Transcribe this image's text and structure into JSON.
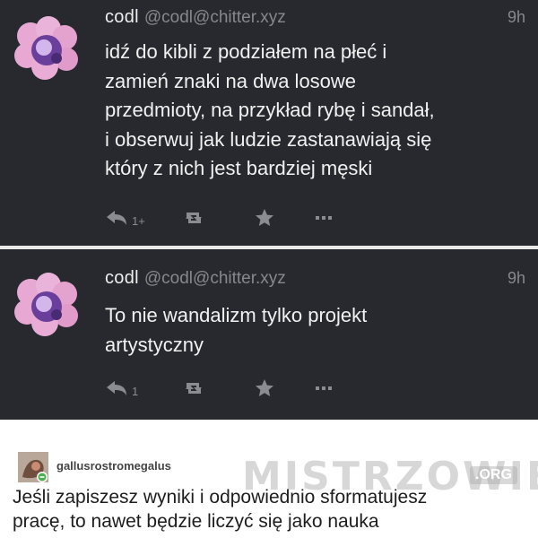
{
  "posts": [
    {
      "display_name": "codl",
      "handle": "@codl@chitter.xyz",
      "time": "9h",
      "text_lines": [
        "idź do kibli z podziałem na płeć i",
        "zamień znaki na dwa losowe",
        "przedmioty, na przykład rybę i sandał,",
        "i obserwuj jak ludzie zastanawiają się",
        "który z nich jest bardziej męski"
      ],
      "reply_count": "1+",
      "icons": {
        "reply": "reply-icon",
        "retweet": "boost-icon",
        "favourite": "star-icon",
        "more": "more-icon"
      }
    },
    {
      "display_name": "codl",
      "handle": "@codl@chitter.xyz",
      "time": "9h",
      "text_lines": [
        "To nie wandalizm tylko projekt",
        "artystyczny"
      ],
      "reply_count": "1",
      "icons": {
        "reply": "reply-icon",
        "retweet": "boost-icon",
        "favourite": "star-icon",
        "more": "more-icon"
      }
    }
  ],
  "comment": {
    "username": "gallusrostromegalus",
    "text_lines": [
      "Jeśli zapiszesz wyniki i odpowiednio sformatujesz",
      "pracę, to nawet będzie liczyć się jako nauka"
    ]
  },
  "watermark": {
    "text": "MISTRZOWIE",
    "badge": ".ORG"
  },
  "colors": {
    "dark_background": "#27292e",
    "text_primary": "#f1f1f1",
    "text_muted": "#86888d",
    "avatar_pink": "#e7a9d4",
    "avatar_purple": "#6a3f9c"
  }
}
